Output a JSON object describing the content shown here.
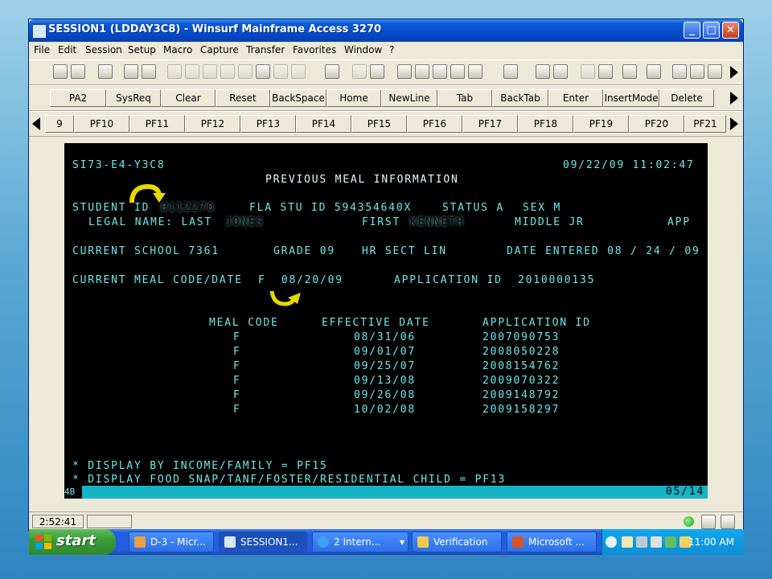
{
  "window": {
    "title": "SESSION1 (LDDAY3C8) - Winsurf Mainframe Access 3270",
    "controls": {
      "minimize": "_",
      "maximize": "□",
      "close": "✕"
    }
  },
  "menu": [
    "File",
    "Edit",
    "Session",
    "Setup",
    "Macro",
    "Capture",
    "Transfer",
    "Favorites",
    "Window",
    "?"
  ],
  "keys_row1": [
    "PA2",
    "SysReq",
    "Clear",
    "Reset",
    "BackSpace",
    "Home",
    "NewLine",
    "Tab",
    "BackTab",
    "Enter",
    "InsertMode",
    "Delete"
  ],
  "keys_row2": [
    "9",
    "PF10",
    "PF11",
    "PF12",
    "PF13",
    "PF14",
    "PF15",
    "PF16",
    "PF17",
    "PF18",
    "PF19",
    "PF20",
    "PF21"
  ],
  "terminal": {
    "screen_id": "SI73-E4-Y3C8",
    "datetime": "09/22/09 11:02:47",
    "heading": "PREVIOUS MEAL INFORMATION",
    "student_id_label": "STUDENT ID",
    "student_id_value": "0112270",
    "fla_stu_id": "FLA STU ID 594354640X",
    "status": "STATUS A",
    "sex": "SEX M",
    "legal_name_label": "LEGAL NAME: LAST",
    "last_name_value": "JONES",
    "first_label": "FIRST",
    "first_name_value": "KENNETH",
    "middle": "MIDDLE JR",
    "app": "APP",
    "current_school": "CURRENT SCHOOL 7361",
    "grade": "GRADE 09",
    "hr_sect": "HR SECT LIN",
    "date_entered": "DATE ENTERED 08 / 24 / 09",
    "meal_code_line": "CURRENT MEAL CODE/DATE  F  08/20/09",
    "application_line": "APPLICATION ID  2010000135",
    "table_headers": [
      "MEAL CODE",
      "EFFECTIVE DATE",
      "APPLICATION ID"
    ],
    "rows": [
      {
        "code": "F",
        "date": "08/31/06",
        "app_id": "2007090753"
      },
      {
        "code": "F",
        "date": "09/01/07",
        "app_id": "2008050228"
      },
      {
        "code": "F",
        "date": "09/25/07",
        "app_id": "2008154762"
      },
      {
        "code": "F",
        "date": "09/13/08",
        "app_id": "2009070322"
      },
      {
        "code": "F",
        "date": "09/26/08",
        "app_id": "2009148792"
      },
      {
        "code": "F",
        "date": "10/02/08",
        "app_id": "2009158297"
      }
    ],
    "footer1": "* DISPLAY BY INCOME/FAMILY = PF15",
    "footer2": "* DISPLAY FOOD SNAP/TANF/FOSTER/RESIDENTIAL CHILD = PF13",
    "status_left": "4B",
    "status_right": "05/14"
  },
  "statusbar": {
    "time": "2:52:41"
  },
  "taskbar": {
    "start": "start",
    "tasks": [
      "D-3 - Micr...",
      "SESSION1...",
      "2 Intern...",
      "Verification",
      "Microsoft ..."
    ],
    "clock": "11:00 AM"
  },
  "colors": {
    "terminal_text": "#6fe6ea",
    "terminal_bg": "#000000",
    "arrow": "#e8d800"
  }
}
